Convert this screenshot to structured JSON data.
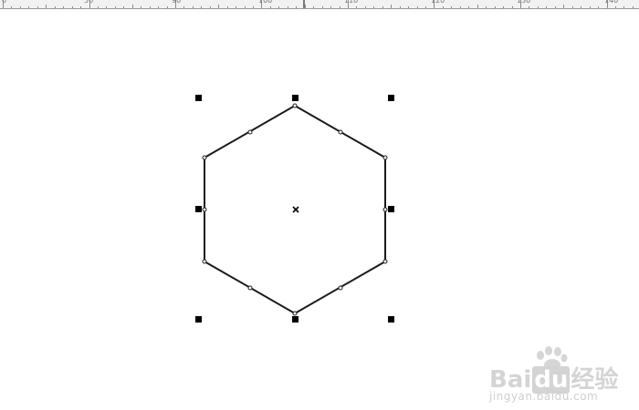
{
  "ruler": {
    "labels": [
      "0",
      "50",
      "90",
      "100",
      "110",
      "120",
      "130",
      "140"
    ]
  },
  "watermark": {
    "brand_pre": "Bai",
    "brand_du": "du",
    "brand_cn": "经验",
    "url": "jingyan.baidu.com"
  },
  "colors": {
    "shape_stroke": "#1a1a1a",
    "handle_fill": "#000000",
    "ruler_bg": "#f2f2f2",
    "watermark": "#d4d4d4"
  },
  "icons": {
    "center_mark": "x-mark-icon",
    "selection_handle": "square-handle",
    "node": "node-dot"
  }
}
